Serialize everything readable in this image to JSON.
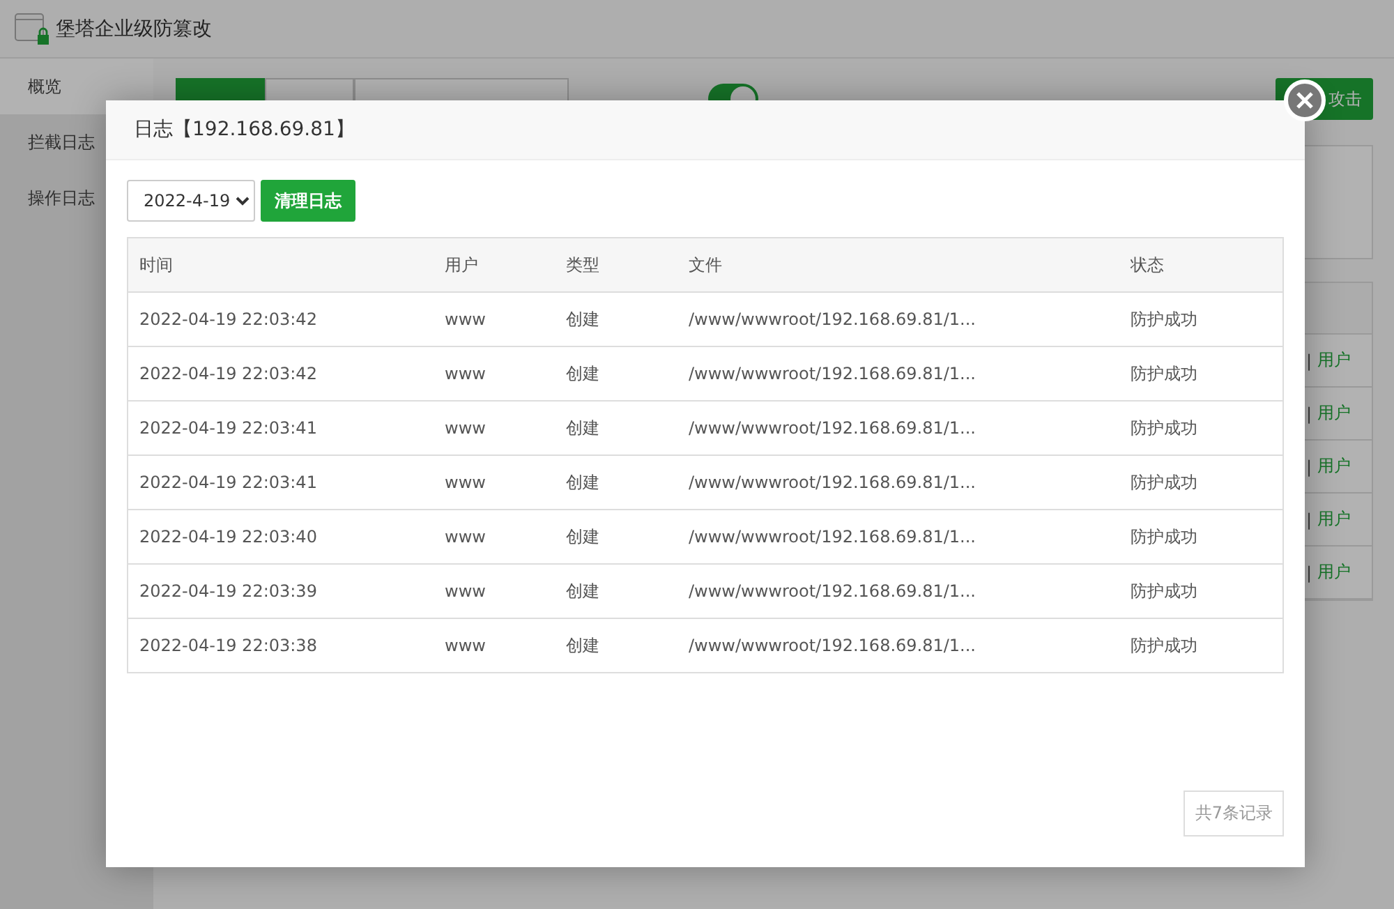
{
  "app": {
    "title": "堡塔企业级防篡改"
  },
  "sidebar": {
    "items": [
      {
        "label": "概览",
        "selected": true
      },
      {
        "label": "拦截日志",
        "selected": false
      },
      {
        "label": "操作日志",
        "selected": false
      }
    ]
  },
  "toolbar": {
    "tabs": [
      {
        "selected": true
      },
      {
        "selected": false
      },
      {
        "selected": false
      }
    ],
    "switch": {
      "on": true
    },
    "action_button": "攻击"
  },
  "background_table": {
    "rows": [
      {
        "separator": "|",
        "link": "用户"
      },
      {
        "separator": "|",
        "link": "用户"
      },
      {
        "separator": "|",
        "link": "用户"
      },
      {
        "separator": "|",
        "link": "用户"
      },
      {
        "separator": "|",
        "link": "用户"
      }
    ]
  },
  "dialog": {
    "title": "日志【192.168.69.81】",
    "date_select": {
      "value": "2022-4-19"
    },
    "clear_button": "清理日志",
    "table": {
      "columns": [
        "时间",
        "用户",
        "类型",
        "文件",
        "状态"
      ],
      "rows": [
        [
          "2022-04-19 22:03:42",
          "www",
          "创建",
          "/www/wwwroot/192.168.69.81/1...",
          "防护成功"
        ],
        [
          "2022-04-19 22:03:42",
          "www",
          "创建",
          "/www/wwwroot/192.168.69.81/1...",
          "防护成功"
        ],
        [
          "2022-04-19 22:03:41",
          "www",
          "创建",
          "/www/wwwroot/192.168.69.81/1...",
          "防护成功"
        ],
        [
          "2022-04-19 22:03:41",
          "www",
          "创建",
          "/www/wwwroot/192.168.69.81/1...",
          "防护成功"
        ],
        [
          "2022-04-19 22:03:40",
          "www",
          "创建",
          "/www/wwwroot/192.168.69.81/1...",
          "防护成功"
        ],
        [
          "2022-04-19 22:03:39",
          "www",
          "创建",
          "/www/wwwroot/192.168.69.81/1...",
          "防护成功"
        ],
        [
          "2022-04-19 22:03:38",
          "www",
          "创建",
          "/www/wwwroot/192.168.69.81/1...",
          "防护成功"
        ]
      ]
    },
    "record_count": "共7条记录"
  }
}
